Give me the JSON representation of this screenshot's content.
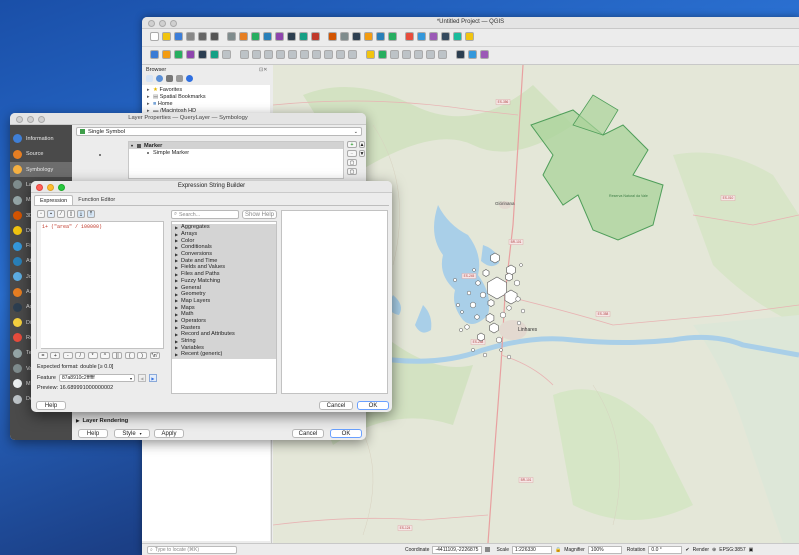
{
  "qgis": {
    "title": "*Untitled Project — QGIS",
    "browser_title": "Browser",
    "browser_items": [
      "Favorites",
      "Spatial Bookmarks",
      "Home",
      "/Macintosh HD"
    ],
    "locate_placeholder": "Type to locate (⌘K)",
    "status": {
      "coordinate_label": "Coordinate",
      "coordinate_value": "-4411109,-2226875",
      "scale_label": "Scale",
      "scale_value": "1:226330",
      "magnifier_label": "Magnifier",
      "magnifier_value": "100%",
      "rotation_label": "Rotation",
      "rotation_value": "0.0 °",
      "render_label": "Render",
      "crs_label": "EPSG:3857"
    },
    "map_labels": {
      "town1": "Glórinana",
      "town2": "Linhares",
      "reserve": "Reserva Natural da Vale",
      "roads": [
        "ES-356",
        "BR-101",
        "ES-245",
        "ES-358",
        "ES-248",
        "BR-101",
        "ES-124",
        "ES-010"
      ]
    }
  },
  "layer_props": {
    "title": "Layer Properties — QueryLayer — Symbology",
    "sidebar": [
      "Information",
      "Source",
      "Symbology",
      "Labels",
      "Masks",
      "3D View",
      "Diagrams",
      "Fields",
      "Attributes Form",
      "Joins",
      "Auxiliary Storage",
      "Actions",
      "Display",
      "Rendering",
      "Temporal",
      "Variables",
      "Metadata",
      "Dependencies"
    ],
    "sidebar_short": [
      "Information",
      "Source",
      "Symbology",
      "La",
      "Ma",
      "3D",
      "Di",
      "Fi",
      "At",
      "Jo",
      "Au",
      "Ac",
      "Di",
      "Re",
      "Te",
      "Va",
      "M",
      "Dependencies"
    ],
    "renderer": "Single Symbol",
    "tree": [
      "Marker",
      "Simple Marker"
    ],
    "layer_rendering": "Layer Rendering",
    "help": "Help",
    "style": "Style",
    "apply": "Apply",
    "cancel": "Cancel",
    "ok": "OK"
  },
  "expr": {
    "title": "Expression String Builder",
    "tabs": [
      "Expression",
      "Function Editor"
    ],
    "expression_prefix": "1+ (",
    "expression_field": "\"area\"",
    "expression_suffix": " / 100000)",
    "operators": [
      "=",
      "+",
      "-",
      "/",
      "*",
      "^",
      "||",
      "(",
      ")",
      "'\\n'"
    ],
    "expected_label": "Expected format:",
    "expected_value": "double [≥ 0.0]",
    "feature_label": "Feature",
    "feature_value": "87a8910c2ffffff",
    "preview_label": "Preview:",
    "preview_value": "16.689991000000002",
    "search_placeholder": "Search...",
    "show_help": "Show Help",
    "categories": [
      "Aggregates",
      "Arrays",
      "Color",
      "Conditionals",
      "Conversions",
      "Date and Time",
      "Fields and Values",
      "Files and Paths",
      "Fuzzy Matching",
      "General",
      "Geometry",
      "Map Layers",
      "Maps",
      "Math",
      "Operators",
      "Rasters",
      "Record and Attributes",
      "String",
      "Variables",
      "Recent (generic)"
    ],
    "help": "Help",
    "cancel": "Cancel",
    "ok": "OK"
  },
  "colors": {
    "map_bg": "#e9e8df",
    "forest": "#cfe3c0",
    "reserve_fill": "#a9d39a",
    "reserve_stroke": "#4f9e5a",
    "water": "#a9cfe8",
    "selection": "#c7c7c7",
    "accent_blue": "#2f6fe0"
  },
  "hex_sizes": [
    22,
    16,
    12,
    10,
    8,
    6,
    5
  ],
  "point_rel_sizes": [
    1.0,
    0.8,
    0.6
  ]
}
